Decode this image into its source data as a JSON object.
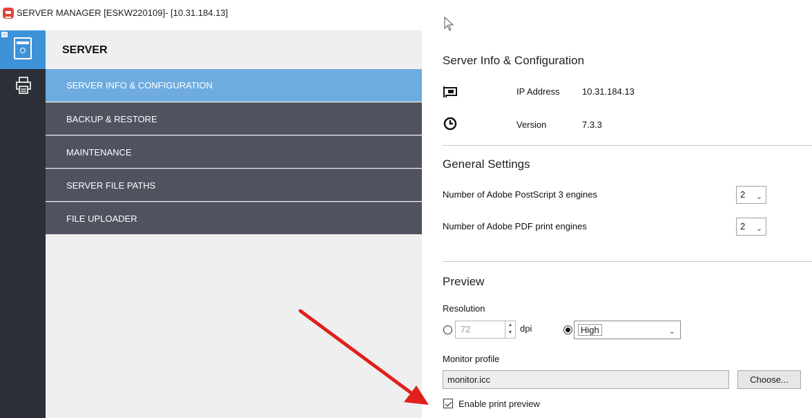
{
  "window": {
    "title": "SERVER MANAGER [ESKW220109]- [10.31.184.13]"
  },
  "rail": {
    "items": [
      {
        "name": "server",
        "icon": "server-icon"
      },
      {
        "name": "printer",
        "icon": "printer-icon"
      }
    ]
  },
  "sidebar": {
    "title": "SERVER",
    "items": [
      {
        "label": "SERVER INFO & CONFIGURATION",
        "active": true
      },
      {
        "label": "BACKUP & RESTORE"
      },
      {
        "label": "MAINTENANCE"
      },
      {
        "label": "SERVER FILE PATHS"
      },
      {
        "label": "FILE UPLOADER"
      }
    ]
  },
  "info": {
    "title": "Server Info & Configuration",
    "ip_label": "IP Address",
    "ip_value": "10.31.184.13",
    "version_label": "Version",
    "version_value": "7.3.3"
  },
  "general": {
    "title": "General Settings",
    "postscript_label": "Number of Adobe PostScript 3 engines",
    "postscript_value": "2",
    "pdf_label": "Number of Adobe PDF print engines",
    "pdf_value": "2"
  },
  "preview": {
    "title": "Preview",
    "resolution_label": "Resolution",
    "dpi_value": "72",
    "dpi_unit": "dpi",
    "resolution_option": "High",
    "monitor_profile_label": "Monitor profile",
    "monitor_profile_value": "monitor.icc",
    "choose_label": "Choose...",
    "enable_label": "Enable print preview",
    "enable_checked": true
  },
  "colors": {
    "rail_bg": "#2c2f37",
    "active_rail": "#3d92d8",
    "active_nav": "#6eacdf",
    "nav_bg": "#4f525f",
    "annotation_arrow": "#e0201b"
  }
}
